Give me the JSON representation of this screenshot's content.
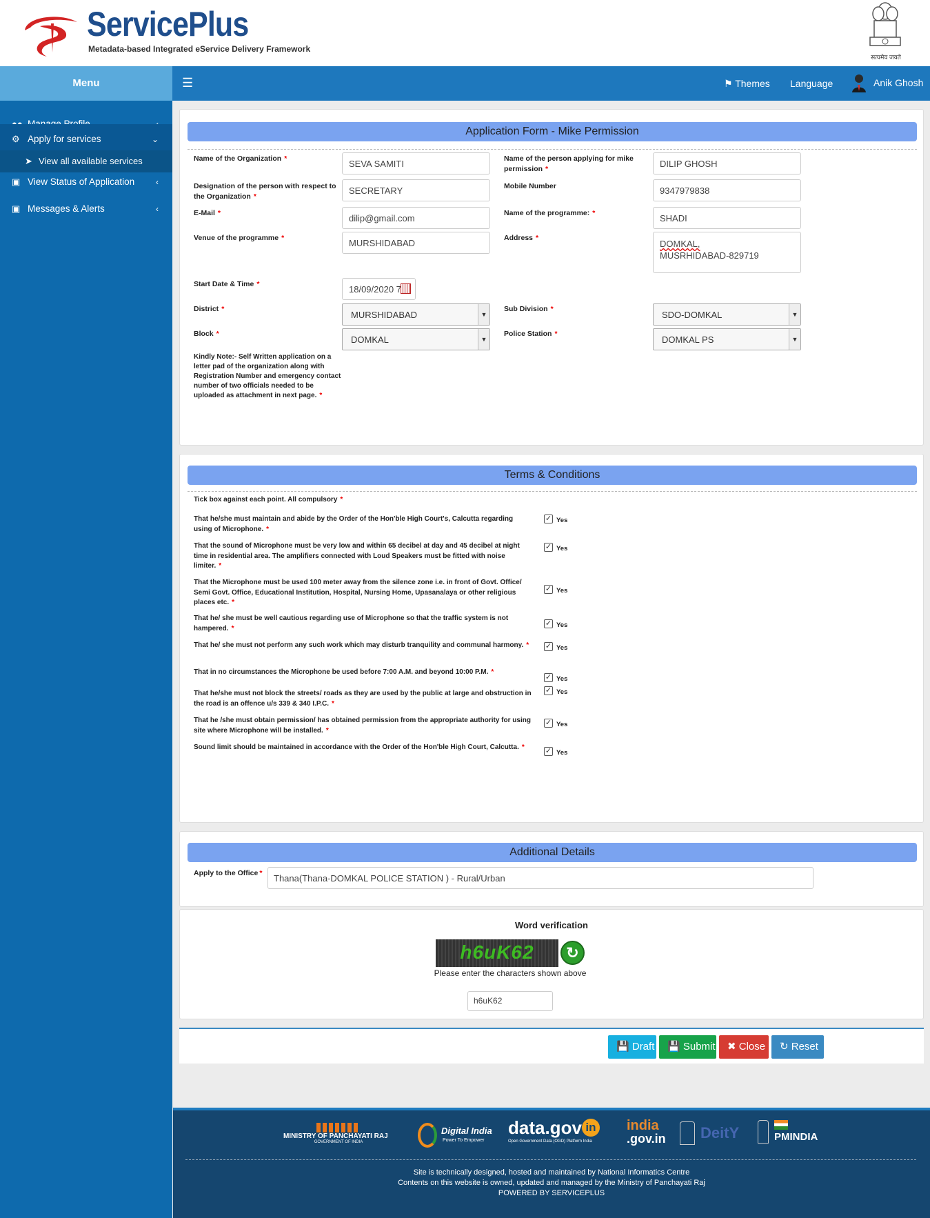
{
  "brand": {
    "name": "ServicePlus",
    "tagline": "Metadata-based Integrated eService Delivery Framework",
    "emblem_text": "सत्यमेव जयते"
  },
  "topbar": {
    "menu": "Menu",
    "themes": "Themes",
    "language": "Language",
    "user": "Anik Ghosh"
  },
  "sidebar": {
    "items": [
      {
        "label": "Manage Profile",
        "icon": "users-icon"
      },
      {
        "label": "Apply for services",
        "icon": "cogs-icon"
      },
      {
        "label": "View all available services",
        "icon": "arrow-circle-icon"
      },
      {
        "label": "View Status of Application",
        "icon": "gamepad-icon"
      },
      {
        "label": "Messages & Alerts",
        "icon": "gamepad-icon"
      }
    ]
  },
  "form": {
    "title": "Application Form - Mike Permission",
    "org_label": "Name of the Organization",
    "org_value": "SEVA SAMITI",
    "applicant_label": "Name of the person applying for mike permission",
    "applicant_value": "DILIP GHOSH",
    "designation_label": "Designation of the person with respect to the Organization",
    "designation_value": "SECRETARY",
    "mobile_label": "Mobile Number",
    "mobile_value": "9347979838",
    "email_label": "E-Mail",
    "email_value": "dilip@gmail.com",
    "programme_label": "Name of the programme:",
    "programme_value": "SHADI",
    "venue_label": "Venue of the programme",
    "venue_value": "MURSHIDABAD",
    "address_label": "Address",
    "address_line1": "DOMKAL,",
    "address_line2": "MUSRHIDABAD-829719",
    "start_label": "Start Date & Time",
    "start_value": "18/09/2020 7",
    "district_label": "District",
    "district_value": "MURSHIDABAD",
    "subdivision_label": "Sub Division",
    "subdivision_value": "SDO-DOMKAL",
    "block_label": "Block",
    "block_value": "DOMKAL",
    "police_label": "Police Station",
    "police_value": "DOMKAL PS",
    "note": "Kindly Note:- Self Written application on a letter pad of the organization along with Registration Number and emergency contact number of two officials needed to be uploaded as attachment in next page."
  },
  "terms": {
    "title": "Terms & Conditions",
    "intro": "Tick box against each point. All compulsory",
    "yes_label": "Yes",
    "items": [
      "That he/she must maintain and abide by the Order of the Hon'ble High Court's, Calcutta regarding using of Microphone.",
      "That the sound of Microphone must be very low and within 65 decibel at day and 45 decibel at night time in residential area. The amplifiers connected with Loud Speakers must be fitted with noise limiter.",
      "That the Microphone must be used 100 meter away from the silence zone i.e. in front of Govt. Office/ Semi Govt. Office, Educational Institution, Hospital, Nursing Home, Upasanalaya or other religious places etc.",
      "That he/ she must be well cautious regarding use of Microphone so that the traffic system is not hampered.",
      "That he/ she must not perform any such work which may disturb tranquility and communal harmony.",
      "That in no circumstances the Microphone be used before 7:00 A.M. and beyond 10:00 P.M.",
      "That he/she must not block the streets/ roads as they are used by the public at large and obstruction in the road is an offence u/s 339 & 340 I.P.C.",
      "That he /she must obtain permission/ has obtained permission from the appropriate authority for using site where Microphone will be installed.",
      "Sound limit should be maintained in accordance with the Order of the Hon'ble High Court, Calcutta."
    ]
  },
  "additional": {
    "title": "Additional Details",
    "office_label": "Apply to the Office",
    "office_value": "Thana(Thana-DOMKAL POLICE STATION ) - Rural/Urban"
  },
  "captcha": {
    "title": "Word verification",
    "code": "h6uK62",
    "hint": "Please enter the characters shown above",
    "input_value": "h6uK62"
  },
  "buttons": {
    "draft": "Draft",
    "submit": "Submit",
    "close": "Close",
    "reset": "Reset"
  },
  "footer": {
    "logos": [
      "MINISTRY OF PANCHAYATI RAJ",
      "GOVERNMENT OF INDIA",
      "Digital India",
      "Power To Empower",
      "data.gov",
      "in",
      "Open Government Data (OGD) Platform India",
      "india",
      ".gov.in",
      "DeitY",
      "PMINDIA"
    ],
    "line1": "Site is technically designed, hosted and maintained by National Informatics Centre",
    "line2": "Contents on this website is owned, updated and managed by the Ministry of Panchayati Raj",
    "line3": "POWERED BY SERVICEPLUS"
  },
  "colors": {
    "sidebar": "#0e6aad",
    "topbar": "#1e78bd",
    "menu_header": "#5aaadc",
    "panel_title": "#7aa3f0",
    "draft": "#17b0e0",
    "submit": "#17a34a",
    "close": "#d63c33",
    "reset": "#3a8ac2",
    "footer": "#15466f"
  }
}
